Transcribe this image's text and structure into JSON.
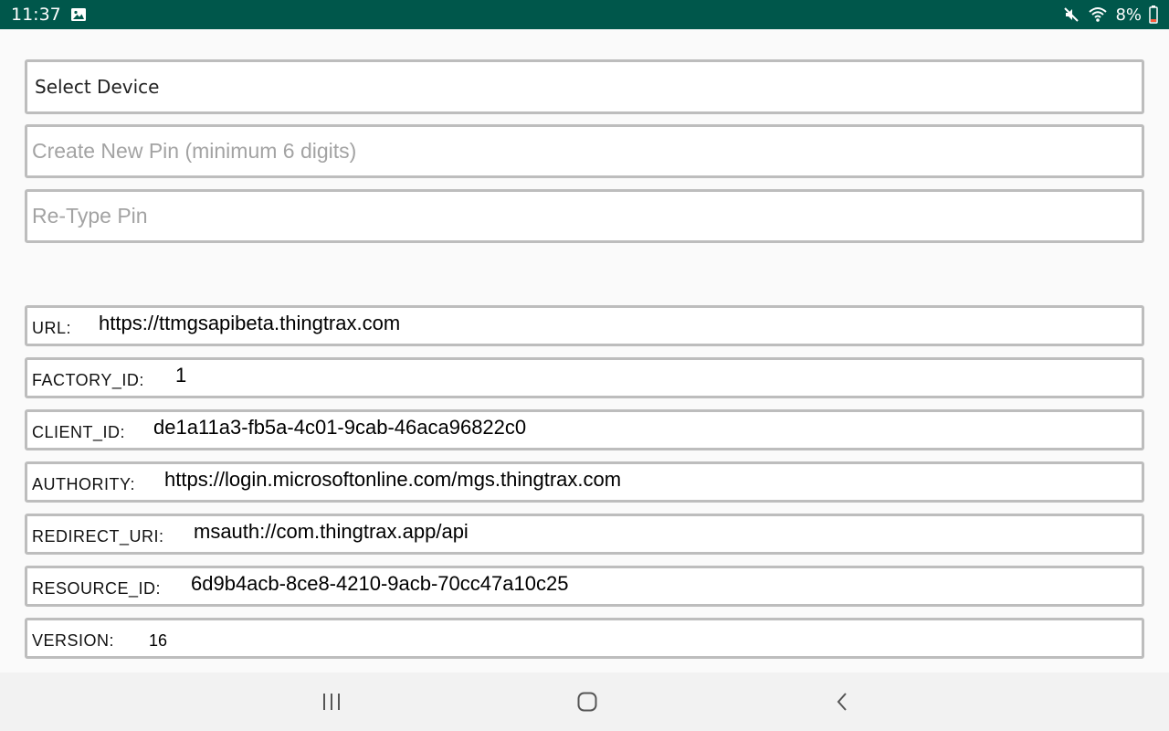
{
  "status_bar": {
    "time": "11:37",
    "battery_percent": "8%",
    "icons": [
      "image-notification-icon",
      "mute-icon",
      "wifi-icon",
      "battery-icon"
    ]
  },
  "device_select": {
    "label": "Select Device"
  },
  "new_pin": {
    "placeholder": "Create New Pin (minimum 6 digits)",
    "value": ""
  },
  "retype_pin": {
    "placeholder": "Re-Type Pin",
    "value": ""
  },
  "config": {
    "url": {
      "label": "URL:",
      "value": "https://ttmgsapibeta.thingtrax.com"
    },
    "factory_id": {
      "label": "FACTORY_ID:",
      "value": "1"
    },
    "client_id": {
      "label": "CLIENT_ID:",
      "value": "de1a11a3-fb5a-4c01-9cab-46aca96822c0"
    },
    "authority": {
      "label": "AUTHORITY:",
      "value": "https://login.microsoftonline.com/mgs.thingtrax.com"
    },
    "redirect_uri": {
      "label": "REDIRECT_URI:",
      "value": "msauth://com.thingtrax.app/api"
    },
    "resource_id": {
      "label": "RESOURCE_ID:",
      "value": "6d9b4acb-8ce8-4210-9acb-70cc47a10c25"
    },
    "version": {
      "label": "VERSION:",
      "value": "16"
    }
  },
  "nav_bar": {
    "buttons": [
      "recent-apps-button",
      "home-button",
      "back-button"
    ]
  }
}
